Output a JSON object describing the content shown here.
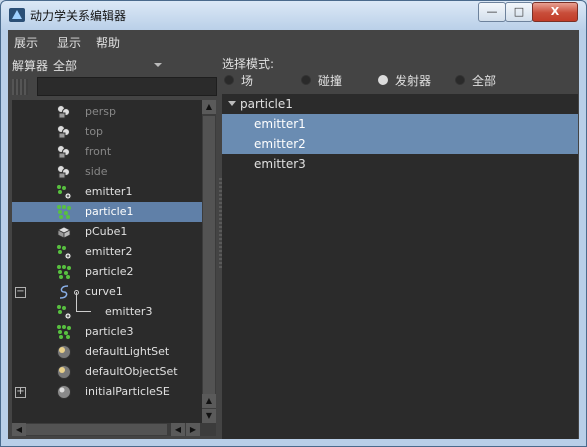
{
  "window": {
    "title": "动力学关系编辑器",
    "min_label": "—",
    "max_label": "□",
    "close_label": "X"
  },
  "menu": [
    "展示",
    "显示",
    "帮助"
  ],
  "outliner": {
    "label": "解算器",
    "value": "全部"
  },
  "tree": [
    {
      "label": "persp",
      "icon": "camera-icon",
      "dim": true
    },
    {
      "label": "top",
      "icon": "camera-icon",
      "dim": true
    },
    {
      "label": "front",
      "icon": "camera-icon",
      "dim": true
    },
    {
      "label": "side",
      "icon": "camera-icon",
      "dim": true
    },
    {
      "label": "emitter1",
      "icon": "emitter-icon"
    },
    {
      "label": "particle1",
      "icon": "particle-icon",
      "selected": true
    },
    {
      "label": "pCube1",
      "icon": "cube-icon"
    },
    {
      "label": "emitter2",
      "icon": "emitter-icon"
    },
    {
      "label": "particle2",
      "icon": "particle-icon"
    },
    {
      "label": "curve1",
      "icon": "curve-icon",
      "expander": "−"
    },
    {
      "label": "emitter3",
      "icon": "emitter-icon",
      "child": true
    },
    {
      "label": "particle3",
      "icon": "particle-icon"
    },
    {
      "label": "defaultLightSet",
      "icon": "set-icon"
    },
    {
      "label": "defaultObjectSet",
      "icon": "set-icon"
    },
    {
      "label": "initialParticleSE",
      "icon": "shading-group-icon",
      "expander": "+"
    }
  ],
  "selection_mode": {
    "label": "选择模式:",
    "options": [
      {
        "label": "场",
        "checked": false
      },
      {
        "label": "碰撞",
        "checked": false
      },
      {
        "label": "发射器",
        "checked": true
      },
      {
        "label": "全部",
        "checked": false
      }
    ]
  },
  "relations": {
    "parent": "particle1",
    "items": [
      {
        "label": "emitter1",
        "selected": true
      },
      {
        "label": "emitter2",
        "selected": true
      },
      {
        "label": "emitter3",
        "selected": false
      }
    ]
  },
  "colors": {
    "panel_bg": "#444444",
    "list_bg": "#2b2b2b",
    "selection": "#6080a8",
    "relation_selection": "#6a8cb2",
    "text": "#e0e0e0",
    "dim_text": "#878787"
  }
}
